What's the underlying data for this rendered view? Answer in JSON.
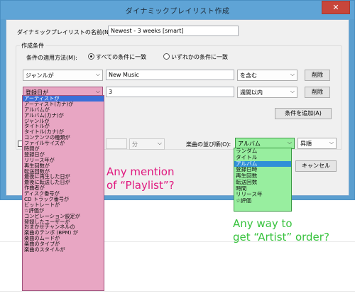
{
  "dialog": {
    "title": "ダイナミックプレイリスト作成",
    "close_label": "✕",
    "name_label": "ダイナミックプレイリストの名前(N):",
    "name_value": "Newest - 3 weeks [smart]",
    "group_label": "作成条件",
    "apply_label": "条件の適用方法(M):",
    "radio_all": "すべての条件に一致",
    "radio_any": "いずれかの条件に一致",
    "row1": {
      "field": "ジャンルが",
      "value": "New Music",
      "op": "を含む",
      "delete": "削除"
    },
    "row2": {
      "field": "登録日が",
      "value": "3",
      "op": "週間以内",
      "delete": "削除"
    },
    "add_condition": "条件を追加(A)",
    "unit_label": "分",
    "sort_label": "楽曲の並び順(O):",
    "sort_value": "アルバム",
    "order_value": "昇順",
    "cancel": "キャンセル"
  },
  "field_list": [
    "アーティストが",
    "アーティスト(カナ)が",
    "アルバムが",
    "アルバム(カナ)が",
    "ジャンルが",
    "タイトルが",
    "タイトル(カナ)が",
    "コンテンツの種類が",
    "ファイルサイズが",
    "時間が",
    "登録日が",
    "リリース年が",
    "再生回数が",
    "転送回数が",
    "最後に再生した日が",
    "最後に転送した日が",
    "作曲者が",
    "ディスク番号が",
    "CD トラック番号が",
    "ビットレートが",
    "☆評価が",
    "コンピレーション設定が",
    "登録したユーザーが",
    "おまかせチャンネルの",
    "楽曲のテンポ (BPM) が",
    "楽曲のムードが",
    "楽曲のタイプが",
    "楽曲のスタイルが"
  ],
  "sort_list": [
    "ランダム",
    "タイトル",
    "アルバム",
    "登録日時",
    "再生回数",
    "転送回数",
    "時間",
    "リリース年",
    "☆評価"
  ],
  "annotations": {
    "note1_line1": "Any mention",
    "note1_line2": "of “Playlist”?",
    "note2_line1": "Any way to",
    "note2_line2": "get “Artist” order?"
  },
  "colors": {
    "accent_pink": "#e0187e",
    "accent_green": "#36c23c",
    "list_pink": "#e8a6c3",
    "list_green": "#98ee9f",
    "title_blue": "#5fa4d6"
  }
}
